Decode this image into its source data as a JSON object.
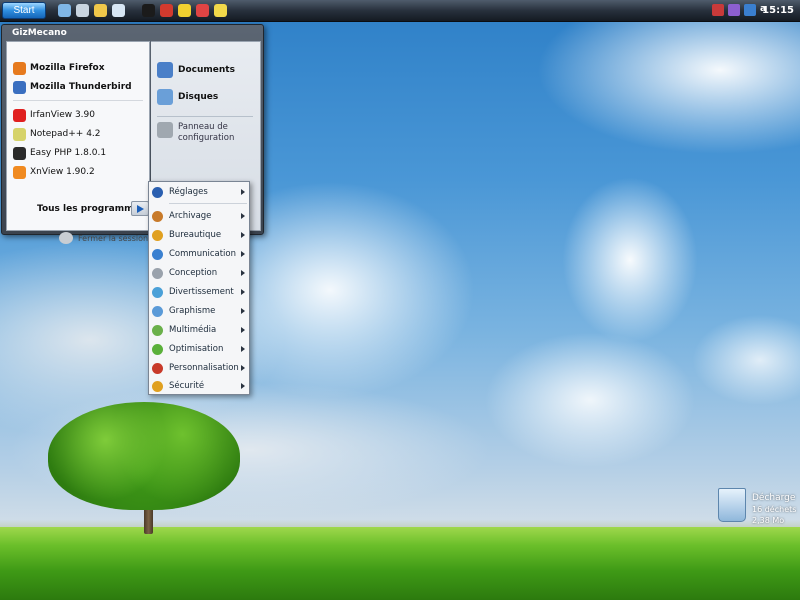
{
  "taskbar": {
    "start_label": "Start",
    "clock": "15:15",
    "tray_badge": "a",
    "quick_launch": [
      {
        "icon": "desktop-icon",
        "color": "#7fb6e6"
      },
      {
        "icon": "trash-icon",
        "color": "#c8d4e0"
      },
      {
        "icon": "folder-icon",
        "color": "#f0c74a"
      },
      {
        "icon": "globe-icon",
        "color": "#d7e6f4"
      },
      {
        "icon": "black-oval-icon",
        "color": "#1b1b1b"
      },
      {
        "icon": "red-shield-icon",
        "color": "#d23a2e"
      },
      {
        "icon": "yellow-flower-icon",
        "color": "#f0d030"
      },
      {
        "icon": "red-mouse-icon",
        "color": "#e04444"
      },
      {
        "icon": "yellow-smiley-icon",
        "color": "#f2d94a"
      }
    ],
    "tray_icons": [
      {
        "icon": "flag-icon",
        "color": "#c83a3a"
      },
      {
        "icon": "network-icon",
        "color": "#8c5fd0"
      },
      {
        "icon": "speaker-icon",
        "color": "#3a7fd0"
      }
    ]
  },
  "start_menu": {
    "title": "GizMecano",
    "pinned": [
      {
        "label": "Mozilla Firefox",
        "icon": "firefox-icon",
        "color": "#e67a1e"
      },
      {
        "label": "Mozilla Thunderbird",
        "icon": "thunderbird-icon",
        "color": "#3a6fc0"
      }
    ],
    "recent": [
      {
        "label": "IrfanView 3.90",
        "icon": "irfanview-icon",
        "color": "#e02020"
      },
      {
        "label": "Notepad++ 4.2",
        "icon": "notepad-icon",
        "color": "#d6d36a"
      },
      {
        "label": "Easy PHP 1.8.0.1",
        "icon": "easyphp-icon",
        "color": "#2a2a2a"
      },
      {
        "label": "XnView 1.90.2",
        "icon": "xnview-icon",
        "color": "#f08a20"
      }
    ],
    "all_programs": "Tous les programmes",
    "logout": "Fermer la session",
    "right": [
      {
        "label": "Documents",
        "icon": "home-icon",
        "color": "#4a7fc8"
      },
      {
        "label": "Disques",
        "icon": "search-icon",
        "color": "#6a9fd8"
      }
    ],
    "control_panel": {
      "line1": "Panneau de",
      "line2": "configuration",
      "icon": "wrench-icon",
      "color": "#a0a8b0"
    }
  },
  "submenu": {
    "items": [
      {
        "label": "Réglages",
        "icon": "info-icon",
        "color": "#2a5fb0"
      },
      {
        "label": "Archivage",
        "icon": "archive-icon",
        "color": "#c87a2a"
      },
      {
        "label": "Bureautique",
        "icon": "office-icon",
        "color": "#e0a020"
      },
      {
        "label": "Communication",
        "icon": "communication-icon",
        "color": "#3a80d0"
      },
      {
        "label": "Conception",
        "icon": "conception-icon",
        "color": "#9aa2ac"
      },
      {
        "label": "Divertissement",
        "icon": "entertainment-icon",
        "color": "#4aa0d8"
      },
      {
        "label": "Graphisme",
        "icon": "graphics-icon",
        "color": "#5a9ad8"
      },
      {
        "label": "Multimédia",
        "icon": "multimedia-icon",
        "color": "#6ab04a"
      },
      {
        "label": "Optimisation",
        "icon": "optimization-icon",
        "color": "#5ab03a"
      },
      {
        "label": "Personnalisation",
        "icon": "personalization-icon",
        "color": "#c83a2a"
      },
      {
        "label": "Sécurité",
        "icon": "security-icon",
        "color": "#e0a020"
      }
    ]
  },
  "desktop": {
    "recycle_bin": {
      "label": "Décharge",
      "count": "16 déchets",
      "size": "2,38 Mo"
    }
  }
}
